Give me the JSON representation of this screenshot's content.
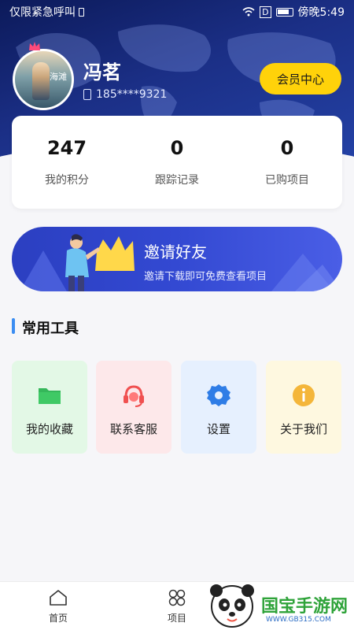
{
  "status_bar": {
    "left_text": "仅限紧急呼叫",
    "right_text": "傍晚5:49"
  },
  "profile": {
    "avatar_text": "海滩",
    "name": "冯茗",
    "phone": "185****9321",
    "vip_label": "会员中心"
  },
  "stats": [
    {
      "value": "247",
      "label": "我的积分"
    },
    {
      "value": "0",
      "label": "跟踪记录"
    },
    {
      "value": "0",
      "label": "已购项目"
    }
  ],
  "banner": {
    "title": "邀请好友",
    "subtitle": "邀请下载即可免费查看项目"
  },
  "tools": {
    "title": "常用工具",
    "items": [
      {
        "label": "我的收藏",
        "icon": "folder-icon",
        "bg": "#e3f8e6"
      },
      {
        "label": "联系客服",
        "icon": "headset-icon",
        "bg": "#fde8ea"
      },
      {
        "label": "设置",
        "icon": "gear-icon",
        "bg": "#e6f0fe"
      },
      {
        "label": "关于我们",
        "icon": "info-icon",
        "bg": "#fef8e0"
      }
    ]
  },
  "nav": {
    "items": [
      {
        "label": "首页",
        "icon": "home-icon"
      },
      {
        "label": "项目",
        "icon": "grid-icon"
      }
    ]
  },
  "watermark": {
    "brand": "国宝手游网",
    "url": "WWW.GB315.COM"
  }
}
